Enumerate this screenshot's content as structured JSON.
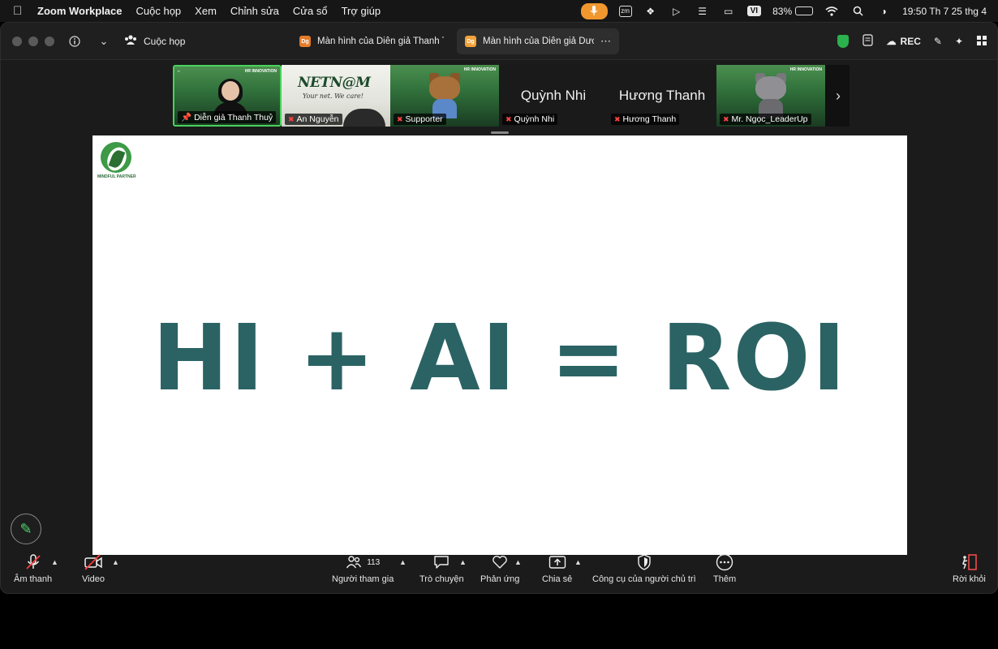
{
  "menubar": {
    "app_name": "Zoom Workplace",
    "items": [
      "Cuộc họp",
      "Xem",
      "Chỉnh sửa",
      "Cửa sổ",
      "Trợ giúp"
    ],
    "tray": {
      "zm_label": "zm",
      "input_lang": "VI",
      "battery": "83%",
      "battery_fraction": 0.83,
      "clock": "19:50 Th 7 25 thg 4"
    }
  },
  "titlebar": {
    "meeting_label": "Cuộc họp",
    "tabs": [
      {
        "badge": "Dg",
        "label": "Màn hình của Diễn giả Thanh Thu"
      },
      {
        "badge": "Dg",
        "label": "Màn hình của Diễn giả Dương"
      }
    ],
    "rec_label": "REC"
  },
  "gallery": {
    "tiles": [
      {
        "name": "Diễn giả Thanh Thuỷ",
        "type": "video-speaker",
        "tag": "HR INNOVATION"
      },
      {
        "name": "An Nguyễn",
        "type": "nettam",
        "logo": "NETN@M",
        "slogan": "Your net. We care!"
      },
      {
        "name": "Supporter",
        "type": "avatar-cat",
        "tag": "HR INNOVATION"
      },
      {
        "name": "Quỳnh Nhi",
        "type": "name-only",
        "display": "Quỳnh Nhi"
      },
      {
        "name": "Hương Thanh",
        "type": "name-only",
        "display": "Hương Thanh"
      },
      {
        "name": "Mr. Ngọc_LeaderUp",
        "type": "avatar-cat-grey",
        "tag": "HR INNOVATION"
      }
    ]
  },
  "share": {
    "logo_text": "MINDFUL PARTNER",
    "title": "HI + AI = ROI"
  },
  "toolbar": {
    "audio": "Âm thanh",
    "video": "Video",
    "participants": "Người tham gia",
    "participants_count": "113",
    "chat": "Trò chuyện",
    "reactions": "Phản ứng",
    "share": "Chia sẻ",
    "host_tools": "Công cụ của người chủ trì",
    "more": "Thêm",
    "leave": "Rời khỏi"
  }
}
